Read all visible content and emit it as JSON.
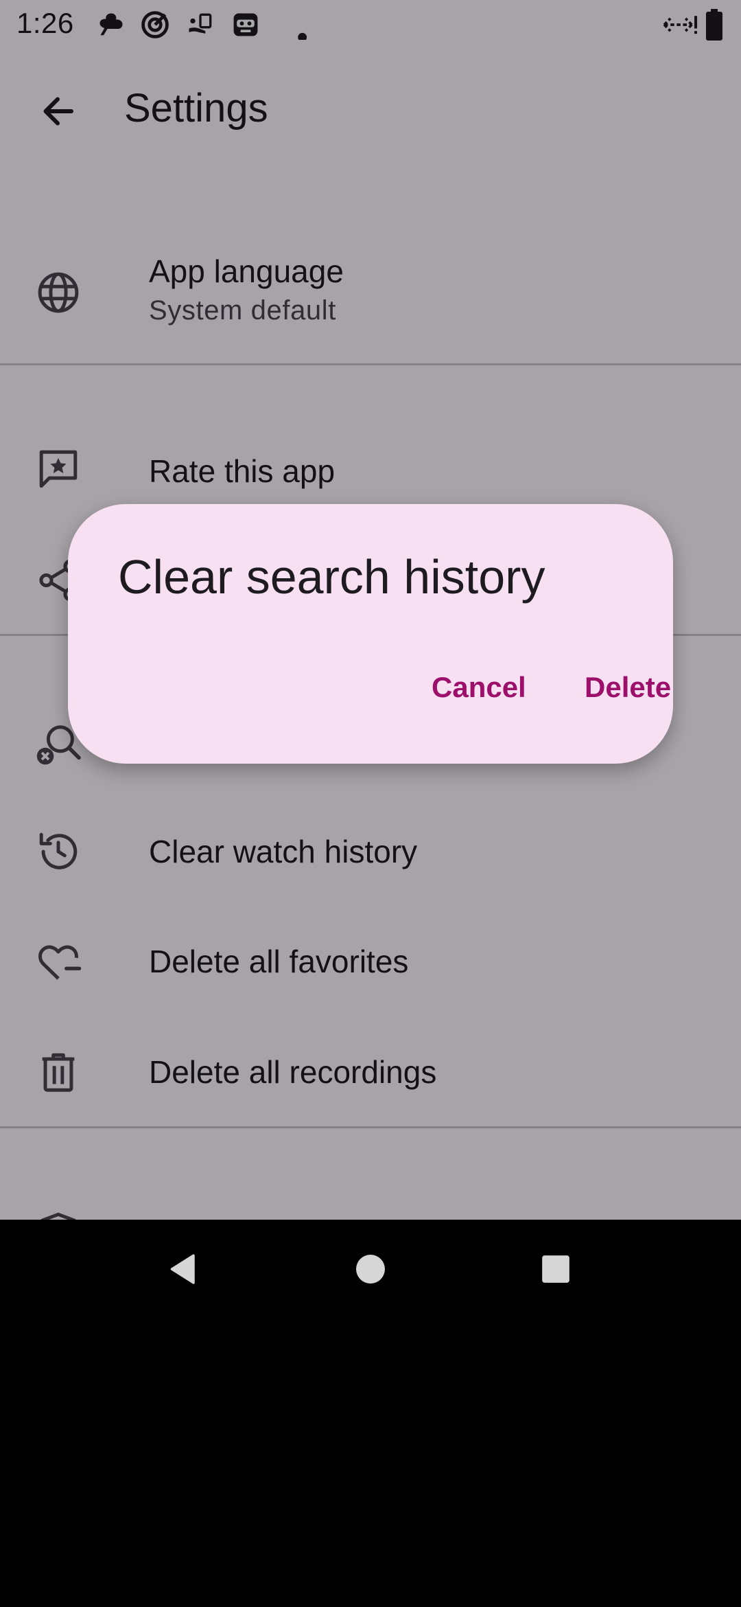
{
  "status_bar": {
    "time": "1:26",
    "left_icons": [
      "clover-icon",
      "target-icon",
      "delivery-icon",
      "robot-icon",
      "dot-icon"
    ],
    "right_icons": [
      "data-transfer-icon",
      "battery-icon"
    ]
  },
  "app_bar": {
    "back_icon": "arrow-back-icon",
    "title": "Settings"
  },
  "settings": {
    "app_language": {
      "title": "App language",
      "subtitle": "System default",
      "icon": "globe-icon"
    },
    "rate_app": {
      "title": "Rate this app",
      "icon": "rate-review-icon"
    },
    "share_app": {
      "icon": "share-icon"
    },
    "clear_search": {
      "icon": "search-off-icon"
    },
    "clear_watch": {
      "title": "Clear watch history",
      "icon": "history-icon"
    },
    "delete_favorites": {
      "title": "Delete all favorites",
      "icon": "heart-minus-icon"
    },
    "delete_recordings": {
      "title": "Delete all recordings",
      "icon": "trash-icon"
    },
    "next_item": {
      "icon": "shield-icon"
    }
  },
  "dialog": {
    "title": "Clear search history",
    "cancel_label": "Cancel",
    "delete_label": "Delete"
  },
  "nav_bar": {
    "back_icon": "nav-back-icon",
    "home_icon": "nav-home-icon",
    "recents_icon": "nav-recents-icon"
  },
  "colors": {
    "background": "#fef7ff",
    "dialog_surface": "#f7e0f1",
    "accent": "#9c0f6a",
    "text_primary": "#1d1b20",
    "text_secondary": "#49454f"
  }
}
